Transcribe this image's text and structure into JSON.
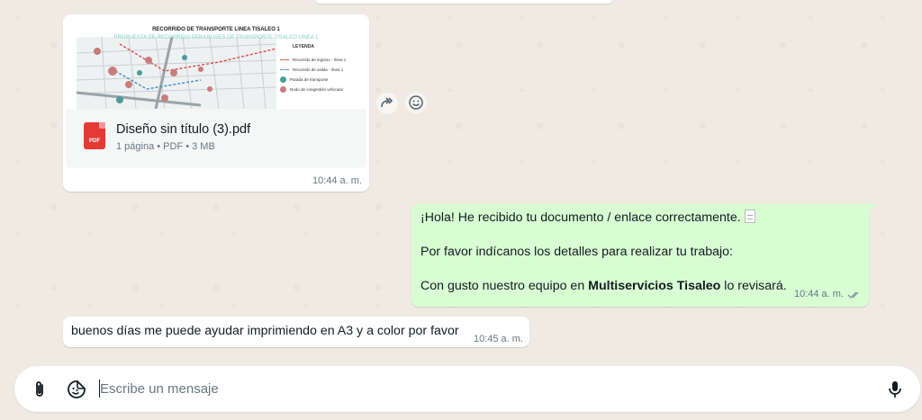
{
  "document_message": {
    "preview": {
      "title": "RECORRIDO DE TRANSPORTE LINEA TISALEO 1",
      "subtitle": "PROPUESTA DE RECORRIDO PARA BUSES DE TRANSPORTE TISALEO LINEA 1",
      "legend_title": "LEYENDA",
      "legend_items": [
        "Recorrido de ingreso - línea 1",
        "Recorrido de salida - línea 1",
        "Parada de transporte",
        "Nodo de congestión vehicular"
      ]
    },
    "file_name": "Diseño sin título (3).pdf",
    "file_meta": "1 página • PDF • 3 MB",
    "pdf_badge": "PDF",
    "time": "10:44 a. m."
  },
  "outgoing_message": {
    "line1": "¡Hola! He recibido tu documento / enlace correctamente.",
    "line2": "Por favor indícanos los detalles para realizar tu trabajo:",
    "line3_prefix": "Con gusto nuestro equipo en ",
    "line3_bold": "Multiservicios Tisaleo",
    "line3_suffix": " lo revisará.",
    "time": "10:44 a. m.",
    "status": "read"
  },
  "incoming_message": {
    "text": "buenos días me puede ayudar imprimiendo en A3 y a color por favor",
    "time": "10:45 a. m."
  },
  "composer": {
    "placeholder": "Escribe un mensaje"
  },
  "icons": {
    "forward": "forward-icon",
    "react": "emoji-icon",
    "attach": "paperclip-icon",
    "sticker": "sticker-icon",
    "mic": "microphone-icon",
    "menu": "chevron-down-icon"
  },
  "colors": {
    "outgoing_bubble": "#d9fdd3",
    "incoming_bubble": "#ffffff",
    "background": "#efeae2",
    "meta_text": "#667781",
    "pdf_red": "#e53935"
  }
}
